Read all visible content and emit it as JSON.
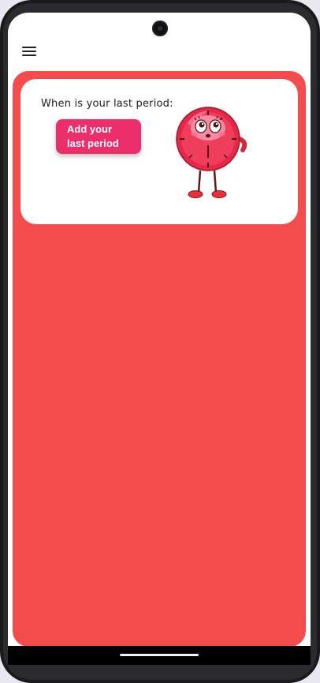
{
  "card": {
    "prompt": "When is your last period:",
    "add_button_label": "Add your last period"
  },
  "icons": {
    "menu": "hamburger-menu-icon",
    "mascot": "clock-mascot-icon"
  },
  "colors": {
    "panel": "#f44c4c",
    "button": "#ec2f6b",
    "card": "#ffffff"
  }
}
